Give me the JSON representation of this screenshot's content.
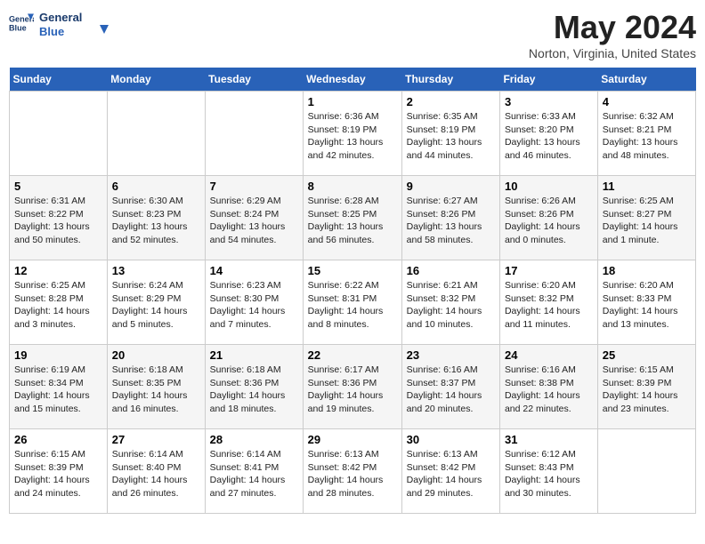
{
  "header": {
    "logo_line1": "General",
    "logo_line2": "Blue",
    "month_title": "May 2024",
    "location": "Norton, Virginia, United States"
  },
  "days_of_week": [
    "Sunday",
    "Monday",
    "Tuesday",
    "Wednesday",
    "Thursday",
    "Friday",
    "Saturday"
  ],
  "weeks": [
    [
      {
        "day": "",
        "sunrise": "",
        "sunset": "",
        "daylight": ""
      },
      {
        "day": "",
        "sunrise": "",
        "sunset": "",
        "daylight": ""
      },
      {
        "day": "",
        "sunrise": "",
        "sunset": "",
        "daylight": ""
      },
      {
        "day": "1",
        "sunrise": "Sunrise: 6:36 AM",
        "sunset": "Sunset: 8:19 PM",
        "daylight": "Daylight: 13 hours and 42 minutes."
      },
      {
        "day": "2",
        "sunrise": "Sunrise: 6:35 AM",
        "sunset": "Sunset: 8:19 PM",
        "daylight": "Daylight: 13 hours and 44 minutes."
      },
      {
        "day": "3",
        "sunrise": "Sunrise: 6:33 AM",
        "sunset": "Sunset: 8:20 PM",
        "daylight": "Daylight: 13 hours and 46 minutes."
      },
      {
        "day": "4",
        "sunrise": "Sunrise: 6:32 AM",
        "sunset": "Sunset: 8:21 PM",
        "daylight": "Daylight: 13 hours and 48 minutes."
      }
    ],
    [
      {
        "day": "5",
        "sunrise": "Sunrise: 6:31 AM",
        "sunset": "Sunset: 8:22 PM",
        "daylight": "Daylight: 13 hours and 50 minutes."
      },
      {
        "day": "6",
        "sunrise": "Sunrise: 6:30 AM",
        "sunset": "Sunset: 8:23 PM",
        "daylight": "Daylight: 13 hours and 52 minutes."
      },
      {
        "day": "7",
        "sunrise": "Sunrise: 6:29 AM",
        "sunset": "Sunset: 8:24 PM",
        "daylight": "Daylight: 13 hours and 54 minutes."
      },
      {
        "day": "8",
        "sunrise": "Sunrise: 6:28 AM",
        "sunset": "Sunset: 8:25 PM",
        "daylight": "Daylight: 13 hours and 56 minutes."
      },
      {
        "day": "9",
        "sunrise": "Sunrise: 6:27 AM",
        "sunset": "Sunset: 8:26 PM",
        "daylight": "Daylight: 13 hours and 58 minutes."
      },
      {
        "day": "10",
        "sunrise": "Sunrise: 6:26 AM",
        "sunset": "Sunset: 8:26 PM",
        "daylight": "Daylight: 14 hours and 0 minutes."
      },
      {
        "day": "11",
        "sunrise": "Sunrise: 6:25 AM",
        "sunset": "Sunset: 8:27 PM",
        "daylight": "Daylight: 14 hours and 1 minute."
      }
    ],
    [
      {
        "day": "12",
        "sunrise": "Sunrise: 6:25 AM",
        "sunset": "Sunset: 8:28 PM",
        "daylight": "Daylight: 14 hours and 3 minutes."
      },
      {
        "day": "13",
        "sunrise": "Sunrise: 6:24 AM",
        "sunset": "Sunset: 8:29 PM",
        "daylight": "Daylight: 14 hours and 5 minutes."
      },
      {
        "day": "14",
        "sunrise": "Sunrise: 6:23 AM",
        "sunset": "Sunset: 8:30 PM",
        "daylight": "Daylight: 14 hours and 7 minutes."
      },
      {
        "day": "15",
        "sunrise": "Sunrise: 6:22 AM",
        "sunset": "Sunset: 8:31 PM",
        "daylight": "Daylight: 14 hours and 8 minutes."
      },
      {
        "day": "16",
        "sunrise": "Sunrise: 6:21 AM",
        "sunset": "Sunset: 8:32 PM",
        "daylight": "Daylight: 14 hours and 10 minutes."
      },
      {
        "day": "17",
        "sunrise": "Sunrise: 6:20 AM",
        "sunset": "Sunset: 8:32 PM",
        "daylight": "Daylight: 14 hours and 11 minutes."
      },
      {
        "day": "18",
        "sunrise": "Sunrise: 6:20 AM",
        "sunset": "Sunset: 8:33 PM",
        "daylight": "Daylight: 14 hours and 13 minutes."
      }
    ],
    [
      {
        "day": "19",
        "sunrise": "Sunrise: 6:19 AM",
        "sunset": "Sunset: 8:34 PM",
        "daylight": "Daylight: 14 hours and 15 minutes."
      },
      {
        "day": "20",
        "sunrise": "Sunrise: 6:18 AM",
        "sunset": "Sunset: 8:35 PM",
        "daylight": "Daylight: 14 hours and 16 minutes."
      },
      {
        "day": "21",
        "sunrise": "Sunrise: 6:18 AM",
        "sunset": "Sunset: 8:36 PM",
        "daylight": "Daylight: 14 hours and 18 minutes."
      },
      {
        "day": "22",
        "sunrise": "Sunrise: 6:17 AM",
        "sunset": "Sunset: 8:36 PM",
        "daylight": "Daylight: 14 hours and 19 minutes."
      },
      {
        "day": "23",
        "sunrise": "Sunrise: 6:16 AM",
        "sunset": "Sunset: 8:37 PM",
        "daylight": "Daylight: 14 hours and 20 minutes."
      },
      {
        "day": "24",
        "sunrise": "Sunrise: 6:16 AM",
        "sunset": "Sunset: 8:38 PM",
        "daylight": "Daylight: 14 hours and 22 minutes."
      },
      {
        "day": "25",
        "sunrise": "Sunrise: 6:15 AM",
        "sunset": "Sunset: 8:39 PM",
        "daylight": "Daylight: 14 hours and 23 minutes."
      }
    ],
    [
      {
        "day": "26",
        "sunrise": "Sunrise: 6:15 AM",
        "sunset": "Sunset: 8:39 PM",
        "daylight": "Daylight: 14 hours and 24 minutes."
      },
      {
        "day": "27",
        "sunrise": "Sunrise: 6:14 AM",
        "sunset": "Sunset: 8:40 PM",
        "daylight": "Daylight: 14 hours and 26 minutes."
      },
      {
        "day": "28",
        "sunrise": "Sunrise: 6:14 AM",
        "sunset": "Sunset: 8:41 PM",
        "daylight": "Daylight: 14 hours and 27 minutes."
      },
      {
        "day": "29",
        "sunrise": "Sunrise: 6:13 AM",
        "sunset": "Sunset: 8:42 PM",
        "daylight": "Daylight: 14 hours and 28 minutes."
      },
      {
        "day": "30",
        "sunrise": "Sunrise: 6:13 AM",
        "sunset": "Sunset: 8:42 PM",
        "daylight": "Daylight: 14 hours and 29 minutes."
      },
      {
        "day": "31",
        "sunrise": "Sunrise: 6:12 AM",
        "sunset": "Sunset: 8:43 PM",
        "daylight": "Daylight: 14 hours and 30 minutes."
      },
      {
        "day": "",
        "sunrise": "",
        "sunset": "",
        "daylight": ""
      }
    ]
  ]
}
